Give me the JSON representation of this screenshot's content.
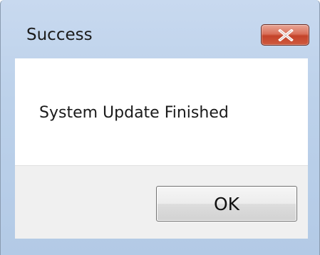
{
  "window": {
    "title": "Success",
    "close_icon": "close-icon"
  },
  "content": {
    "message": "System Update Finished"
  },
  "footer": {
    "ok_label": "OK"
  },
  "colors": {
    "frame": "#bcd1ea",
    "close_button": "#c4432a",
    "content_bg": "#ffffff",
    "footer_bg": "#f0f0f0"
  }
}
